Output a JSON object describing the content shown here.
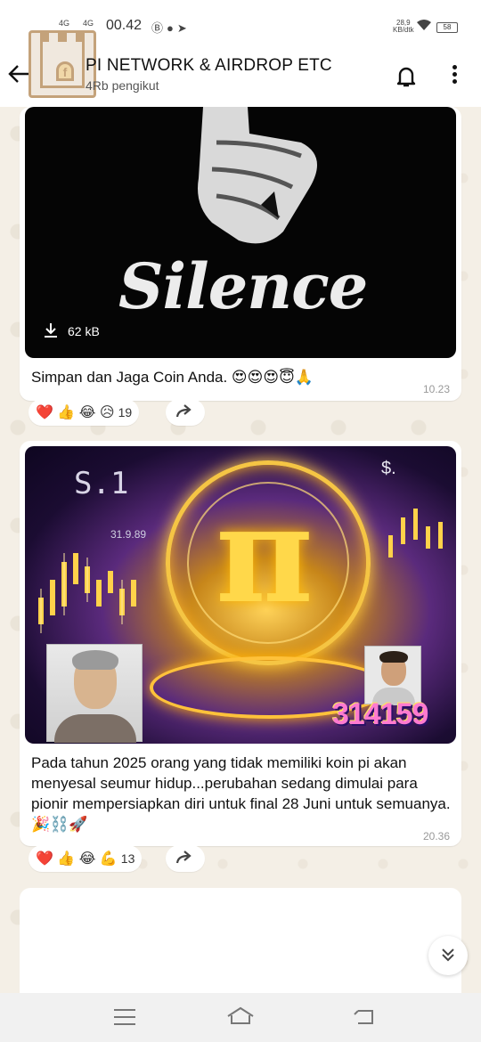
{
  "status_bar": {
    "net1": "4G",
    "net2": "4G",
    "time": "00.42",
    "speed_value": "28,9",
    "speed_unit": "KB/dtk",
    "battery": "58"
  },
  "header": {
    "title": "PI NETWORK & AIRDROP ETC",
    "subtitle": "4Rb pengikut"
  },
  "messages": [
    {
      "image_caption": "Silence",
      "download_size": "62 kB",
      "text": "Simpan dan Jaga Coin Anda. 😍😍😍😇🙏",
      "time": "10.23",
      "reactions": "❤️ 👍 😂 😥",
      "reaction_count": "19"
    },
    {
      "image_texts": {
        "top_left": "S.1",
        "ticker": "31.9.89",
        "dollar": "$.",
        "symbol": "π",
        "number": "314159"
      },
      "text": "Pada tahun 2025 orang yang tidak memiliki koin pi akan menyesal seumur hidup...perubahan sedang dimulai para pionir mempersiapkan diri untuk final 28 Juni untuk semuanya.🎉⛓️🚀",
      "time": "20.36",
      "reactions": "❤️ 👍 😂 💪",
      "reaction_count": "13"
    }
  ],
  "icons": {
    "back": "arrow-left-icon",
    "bell": "bell-icon",
    "more": "more-vertical-icon",
    "download": "download-icon",
    "share": "share-forward-icon",
    "scroll_down": "double-chevron-down-icon"
  },
  "colors": {
    "wallpaper": "#f3eee4",
    "bubble": "#ffffff",
    "avatar_accent": "#c4a27a"
  }
}
